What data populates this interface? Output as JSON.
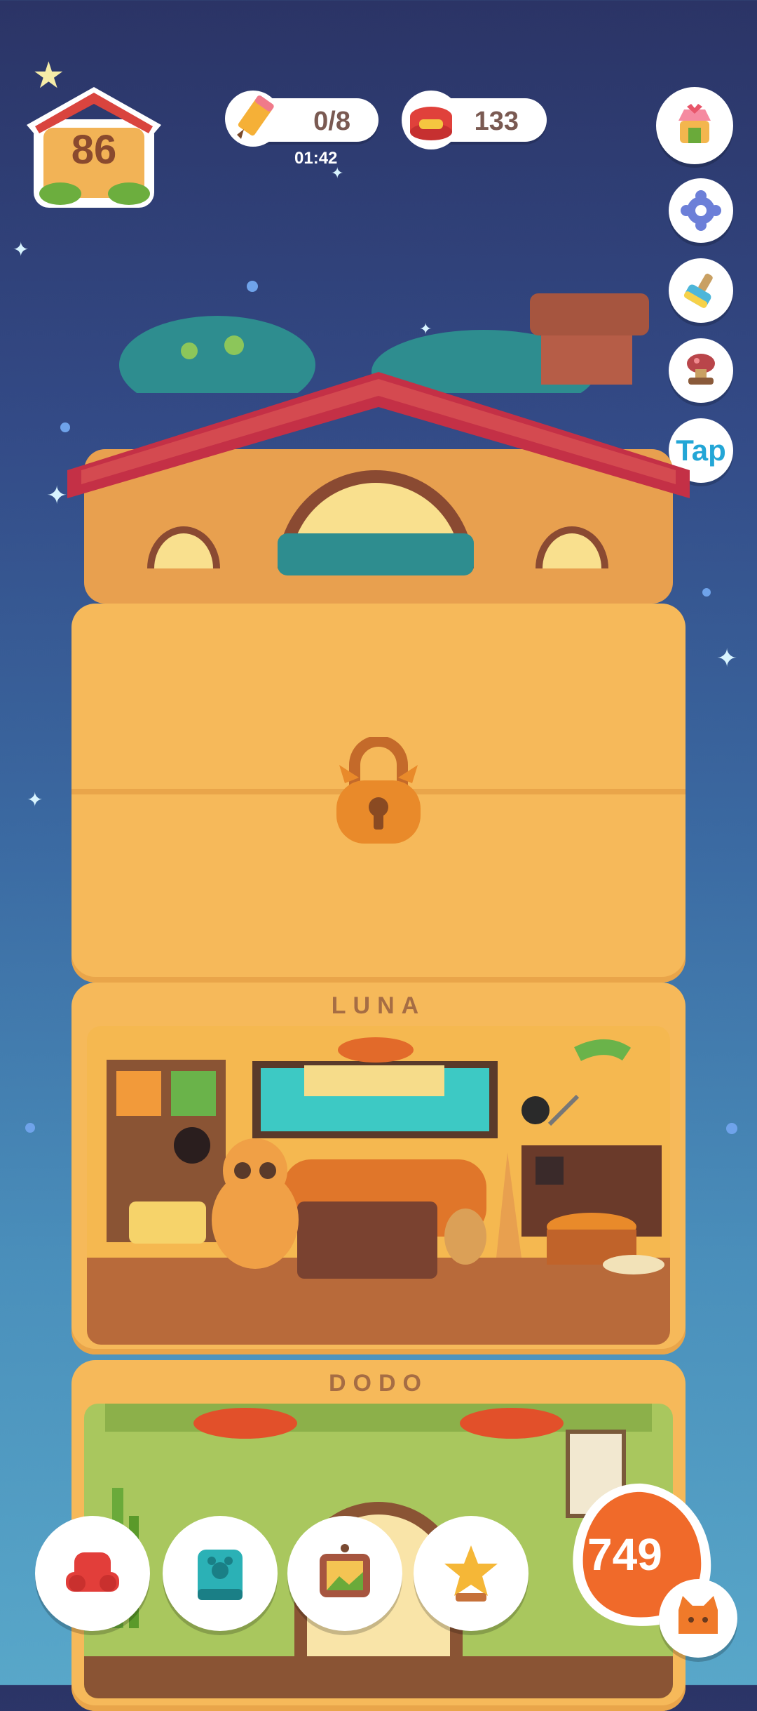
{
  "hud": {
    "house_level": "86",
    "pencil_counter": "0/8",
    "pencil_timer": "01:42",
    "fish_can_count": "133"
  },
  "side_buttons": {
    "tap_label": "Tap",
    "icons": [
      "shop-icon",
      "settings-gear-icon",
      "paint-brush-icon",
      "stamp-icon",
      "tap-icon"
    ]
  },
  "rooms": [
    {
      "id": "attic",
      "label": ""
    },
    {
      "id": "locked",
      "label": ""
    },
    {
      "id": "luna",
      "label": "LUNA"
    },
    {
      "id": "dodo",
      "label": "DODO"
    }
  ],
  "bottom_bar": {
    "coin_count": "749",
    "icons": [
      "furniture-icon",
      "cat-book-icon",
      "picture-frame-icon",
      "trophy-icon",
      "cat-face-icon"
    ]
  },
  "colors": {
    "sky_top": "#2b3466",
    "sky_bottom": "#58a7c9",
    "roof": "#c23a4a",
    "wall": "#f6b95a",
    "coin_badge": "#f06a2a",
    "tap_text": "#23a6d6"
  }
}
